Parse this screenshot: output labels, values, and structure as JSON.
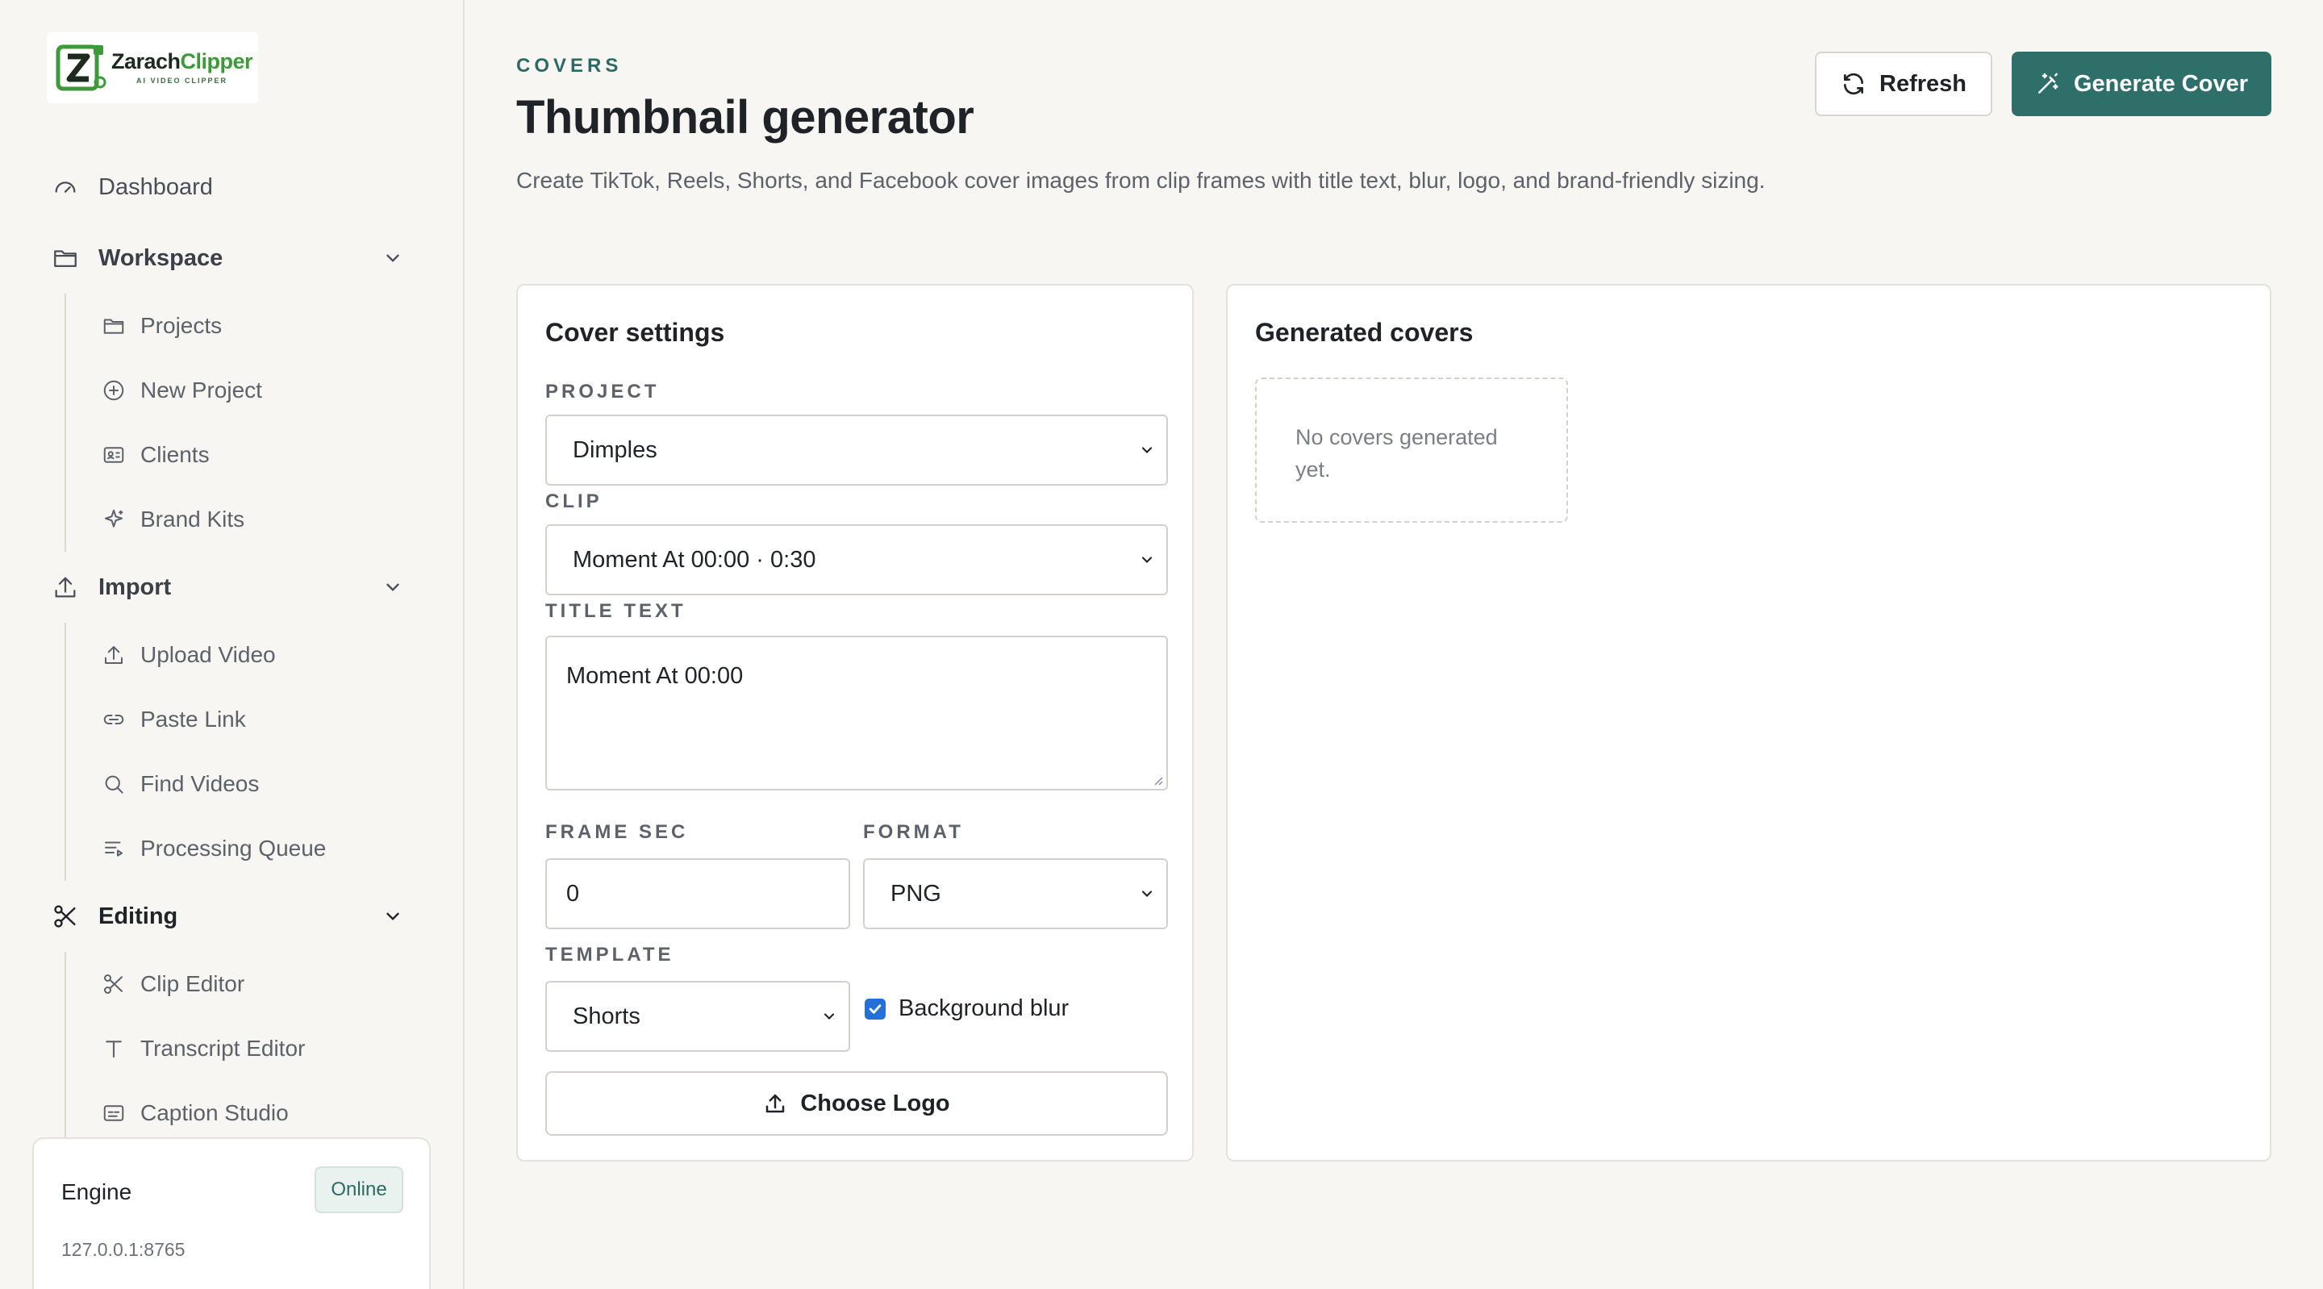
{
  "brand": {
    "name_part1": "Zarach",
    "name_part2": "Clipper",
    "tagline": "AI VIDEO CLIPPER",
    "accent": "#3c9a3a"
  },
  "sidebar": {
    "dashboard": {
      "label": "Dashboard",
      "icon": "gauge-icon"
    },
    "sections": [
      {
        "label": "Workspace",
        "icon": "folder-icon",
        "expanded": true,
        "items": [
          {
            "label": "Projects",
            "icon": "folder-icon"
          },
          {
            "label": "New Project",
            "icon": "plus-circle-icon"
          },
          {
            "label": "Clients",
            "icon": "id-card-icon"
          },
          {
            "label": "Brand Kits",
            "icon": "sparkle-icon"
          }
        ]
      },
      {
        "label": "Import",
        "icon": "upload-icon",
        "expanded": true,
        "items": [
          {
            "label": "Upload Video",
            "icon": "upload-icon"
          },
          {
            "label": "Paste Link",
            "icon": "link-icon"
          },
          {
            "label": "Find Videos",
            "icon": "search-icon"
          },
          {
            "label": "Processing Queue",
            "icon": "queue-icon"
          }
        ]
      },
      {
        "label": "Editing",
        "icon": "scissors-icon",
        "expanded": true,
        "items": [
          {
            "label": "Clip Editor",
            "icon": "scissors-icon"
          },
          {
            "label": "Transcript Editor",
            "icon": "text-icon"
          },
          {
            "label": "Caption Studio",
            "icon": "caption-icon"
          }
        ]
      }
    ],
    "engine": {
      "title": "Engine",
      "status": "Online",
      "address": "127.0.0.1:8765"
    }
  },
  "header": {
    "eyebrow": "COVERS",
    "title": "Thumbnail generator",
    "description": "Create TikTok, Reels, Shorts, and Facebook cover images from clip frames with title text, blur, logo, and brand-friendly sizing.",
    "refresh_label": "Refresh",
    "generate_label": "Generate Cover",
    "primary_color": "#2f6f6a"
  },
  "settings": {
    "title": "Cover settings",
    "project_label": "PROJECT",
    "project_value": "Dimples",
    "clip_label": "CLIP",
    "clip_value": "Moment At 00:00 · 0:30",
    "title_text_label": "TITLE TEXT",
    "title_text_value": "Moment At 00:00",
    "frame_sec_label": "FRAME SEC",
    "frame_sec_value": "0",
    "format_label": "FORMAT",
    "format_value": "PNG",
    "template_label": "TEMPLATE",
    "template_value": "Shorts",
    "blur_label": "Background blur",
    "blur_checked": true,
    "choose_logo_label": "Choose Logo"
  },
  "covers": {
    "title": "Generated covers",
    "empty_text": "No covers generated yet."
  }
}
